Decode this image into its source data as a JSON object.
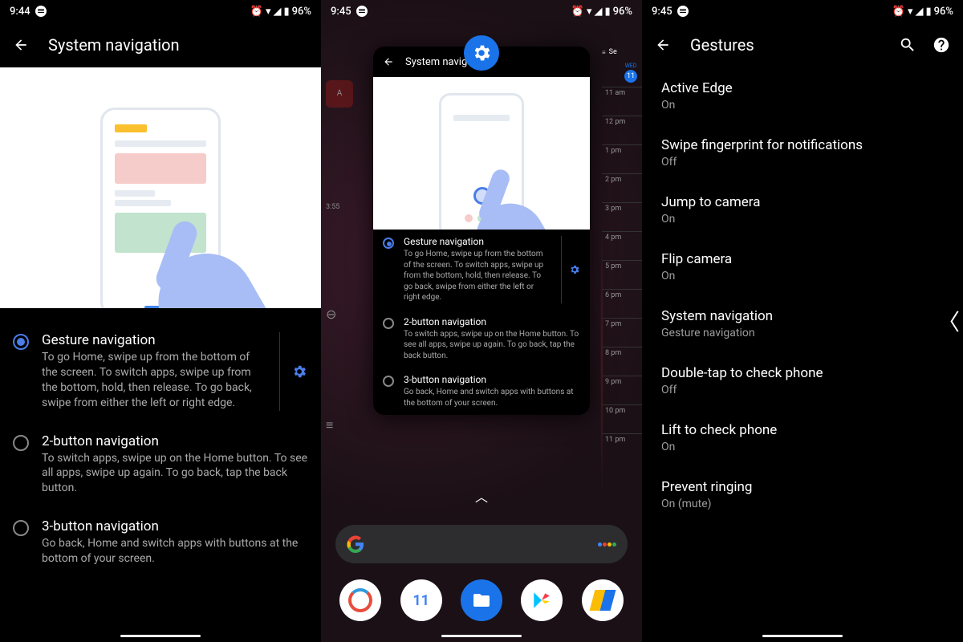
{
  "status": {
    "time1": "9:44",
    "time2": "9:45",
    "time3": "9:45",
    "battery": "96%"
  },
  "screen1": {
    "title": "System navigation",
    "options": [
      {
        "title": "Gesture navigation",
        "desc": "To go Home, swipe up from the bottom of the screen. To switch apps, swipe up from the bottom, hold, then release. To go back, swipe from either the left or right edge.",
        "selected": true,
        "hasGear": true
      },
      {
        "title": "2-button navigation",
        "desc": "To switch apps, swipe up on the Home button. To see all apps, swipe up again. To go back, tap the back button.",
        "selected": false,
        "hasGear": false
      },
      {
        "title": "3-button navigation",
        "desc": "Go back, Home and switch apps with buttons at the bottom of your screen.",
        "selected": false,
        "hasGear": false
      }
    ]
  },
  "screen2": {
    "title": "System navigation",
    "settingsBadge": "settings-gear",
    "calendar": {
      "dayLabel": "WED",
      "dayNum": "11",
      "hours": [
        "11 am",
        "12 pm",
        "1 pm",
        "2 pm",
        "3 pm",
        "4 pm",
        "5 pm",
        "6 pm",
        "7 pm",
        "8 pm",
        "9 pm",
        "10 pm",
        "11 pm"
      ]
    },
    "searchHint": "Se",
    "leftStrip": {
      "appLetter": "A",
      "time": "3:55"
    },
    "options": [
      {
        "title": "Gesture navigation",
        "desc": "To go Home, swipe up from the bottom of the screen. To switch apps, swipe up from the bottom, hold, then release. To go back, swipe from either the left or right edge.",
        "selected": true,
        "hasGear": true
      },
      {
        "title": "2-button navigation",
        "desc": "To switch apps, swipe up on the Home button. To see all apps, swipe up again. To go back, tap the back button.",
        "selected": false,
        "hasGear": false
      },
      {
        "title": "3-button navigation",
        "desc": "Go back, Home and switch apps with buttons at the bottom of your screen.",
        "selected": false,
        "hasGear": false
      }
    ],
    "apps": [
      {
        "name": "ccleaner",
        "color": "#e74c3c",
        "letter": "C"
      },
      {
        "name": "calendar",
        "color": "#4285f4",
        "letter": "11"
      },
      {
        "name": "files",
        "color": "#1a73e8",
        "letter": ""
      },
      {
        "name": "play-store",
        "color": "#fff",
        "letter": "▶"
      },
      {
        "name": "adsense",
        "color": "#fbbc04",
        "letter": ""
      }
    ]
  },
  "screen3": {
    "title": "Gestures",
    "items": [
      {
        "title": "Active Edge",
        "value": "On"
      },
      {
        "title": "Swipe fingerprint for notifications",
        "value": "Off"
      },
      {
        "title": "Jump to camera",
        "value": "On"
      },
      {
        "title": "Flip camera",
        "value": "On"
      },
      {
        "title": "System navigation",
        "value": "Gesture navigation"
      },
      {
        "title": "Double-tap to check phone",
        "value": "Off"
      },
      {
        "title": "Lift to check phone",
        "value": "On"
      },
      {
        "title": "Prevent ringing",
        "value": "On (mute)"
      }
    ]
  }
}
